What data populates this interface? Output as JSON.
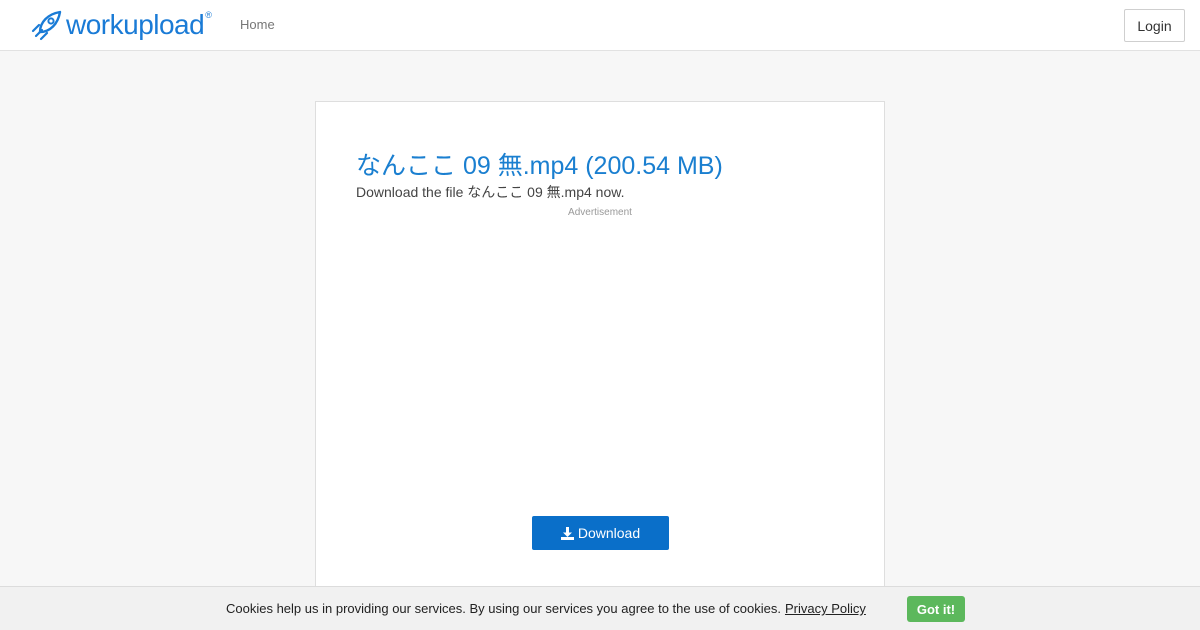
{
  "header": {
    "logo_text": "workupload",
    "logo_mark": "®",
    "nav_home": "Home",
    "login_label": "Login"
  },
  "file": {
    "title": "なんここ 09 無.mp4 (200.54 MB)",
    "subtitle": "Download the file なんここ 09 無.mp4 now.",
    "ad_label": "Advertisement",
    "download_label": "Download",
    "download_icon": "download-icon"
  },
  "cookie": {
    "text": "Cookies help us in providing our services. By using our services you agree to the use of cookies.",
    "link_label": "Privacy Policy",
    "accept_label": "Got it!"
  },
  "colors": {
    "brand": "#1a7bd6",
    "download_button": "#0a6fc9",
    "accept_button": "#5cb85c"
  }
}
